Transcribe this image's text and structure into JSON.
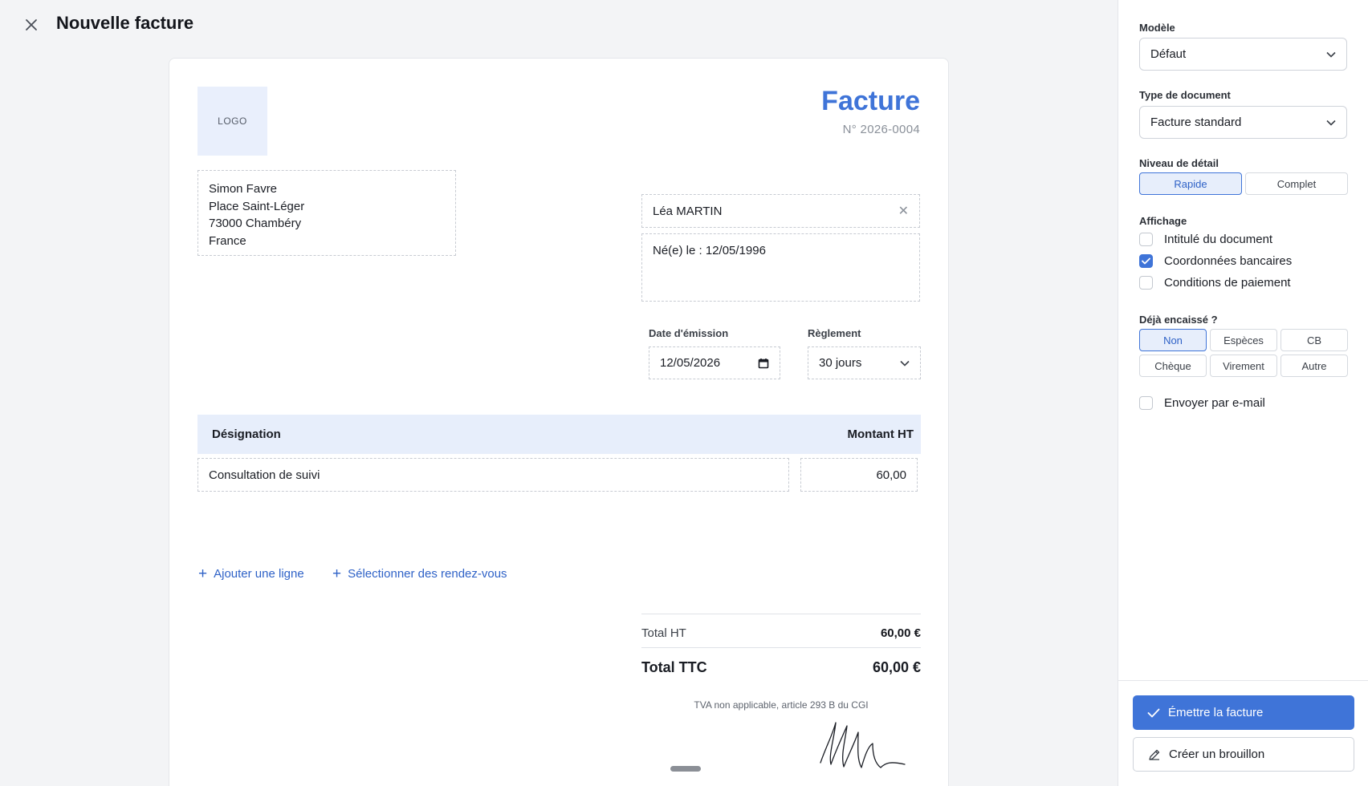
{
  "header": {
    "title": "Nouvelle facture"
  },
  "invoice": {
    "logo_text": "LOGO",
    "title": "Facture",
    "number": "N° 2026-0004",
    "sender": {
      "name": "Simon Favre",
      "street": "Place Saint-Léger",
      "city": "73000 Chambéry",
      "country": "France"
    },
    "client": {
      "name": "Léa MARTIN",
      "details": "Né(e) le : 12/05/1996"
    },
    "issue_date": {
      "label": "Date d'émission",
      "value": "12/05/2026"
    },
    "payment_terms": {
      "label": "Règlement",
      "value": "30 jours"
    },
    "table": {
      "columns": [
        "Désignation",
        "Montant HT"
      ],
      "rows": [
        {
          "designation": "Consultation de suivi",
          "amount": "60,00"
        }
      ]
    },
    "actions": {
      "add_line": "Ajouter une ligne",
      "select_appointments": "Sélectionner des rendez-vous"
    },
    "totals": {
      "ht_label": "Total HT",
      "ht_value": "60,00 €",
      "ttc_label": "Total TTC",
      "ttc_value": "60,00 €"
    },
    "tva_note": "TVA non applicable, article 293 B du CGI"
  },
  "panel": {
    "template": {
      "label": "Modèle",
      "value": "Défaut"
    },
    "doc_type": {
      "label": "Type de document",
      "value": "Facture standard"
    },
    "detail_level": {
      "label": "Niveau de détail",
      "options": [
        "Rapide",
        "Complet"
      ],
      "selected": "Rapide"
    },
    "display": {
      "label": "Affichage",
      "options": [
        {
          "label": "Intitulé du document",
          "checked": false
        },
        {
          "label": "Coordonnées bancaires",
          "checked": true
        },
        {
          "label": "Conditions de paiement",
          "checked": false
        }
      ]
    },
    "collected": {
      "label": "Déjà encaissé ?",
      "options": [
        "Non",
        "Espèces",
        "CB",
        "Chèque",
        "Virement",
        "Autre"
      ],
      "selected": "Non"
    },
    "send_email": {
      "label": "Envoyer par e-mail",
      "checked": false
    },
    "buttons": {
      "issue": "Émettre la facture",
      "draft": "Créer un brouillon"
    }
  },
  "colors": {
    "accent": "#3f74d8",
    "accent_light": "#e7eefb"
  }
}
